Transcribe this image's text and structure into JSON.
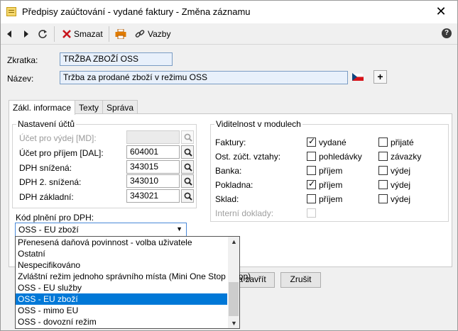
{
  "window": {
    "title": "Předpisy zaúčtování - vydané faktury - Změna záznamu",
    "close": "✕"
  },
  "toolbar": {
    "delete_label": "Smazat",
    "links_label": "Vazby",
    "help": "?"
  },
  "form": {
    "zkratka_label": "Zkratka:",
    "zkratka_value": "TRŽBA ZBOŽÍ OSS",
    "nazev_label": "Název:",
    "nazev_value": "Tržba za prodané zboží v režimu OSS"
  },
  "tabs": [
    "Zákl. informace",
    "Texty",
    "Správa"
  ],
  "accounts": {
    "title": "Nastavení účtů",
    "rows": [
      {
        "label": "Účet pro výdej [MD]:",
        "value": "",
        "disabled": true
      },
      {
        "label": "Účet pro příjem [DAL]:",
        "value": "604001"
      },
      {
        "label": "DPH snížená:",
        "value": "343015"
      },
      {
        "label": "DPH 2. snížená:",
        "value": "343010"
      },
      {
        "label": "DPH základní:",
        "value": "343021"
      }
    ]
  },
  "visibility": {
    "title": "Viditelnost v modulech",
    "rows": [
      {
        "label": "Faktury:",
        "a": "vydané",
        "a_checked": true,
        "b": "přijaté",
        "b_checked": false
      },
      {
        "label": "Ost. zúčt. vztahy:",
        "a": "pohledávky",
        "a_checked": false,
        "b": "závazky",
        "b_checked": false
      },
      {
        "label": "Banka:",
        "a": "příjem",
        "a_checked": false,
        "b": "výdej",
        "b_checked": false
      },
      {
        "label": "Pokladna:",
        "a": "příjem",
        "a_checked": true,
        "b": "výdej",
        "b_checked": false
      },
      {
        "label": "Sklad:",
        "a": "příjem",
        "a_checked": false,
        "b": "výdej",
        "b_checked": false
      }
    ],
    "internal_label": "Interní doklady:"
  },
  "vat": {
    "label": "Kód plnění pro DPH:",
    "selected": "OSS - EU zboží",
    "options": [
      "Přenesená daňová povinnost - volba uživatele",
      "Ostatní",
      "Nespecifikováno",
      "Zvláštní režim jednoho správního místa (Mini One Stop Shop)",
      "OSS - EU služby",
      "OSS - EU zboží",
      "OSS - mimo EU",
      "OSS - dovozní režim"
    ],
    "selected_index": 5
  },
  "buttons": {
    "save_close": "a zavřít",
    "cancel": "Zrušit"
  }
}
